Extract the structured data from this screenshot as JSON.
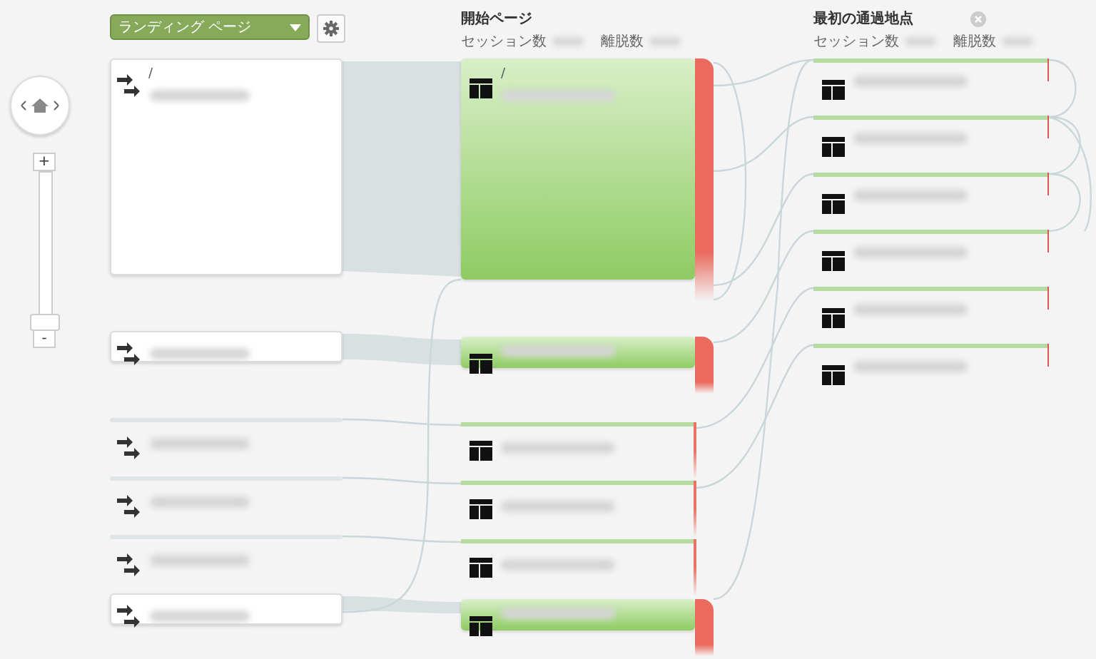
{
  "dimension_selector": {
    "label": "ランディング ページ"
  },
  "navigation": {
    "zoom_in": "+",
    "zoom_out": "-"
  },
  "columns": [
    {
      "title": "開始ページ",
      "metrics": [
        "セッション数",
        "離脱数"
      ],
      "closable": false
    },
    {
      "title": "最初の通過地点",
      "metrics": [
        "セッション数",
        "離脱数"
      ],
      "closable": true
    }
  ],
  "landing_pages": [
    {
      "kind": "tall",
      "path": "/"
    },
    {
      "kind": "bar"
    },
    {
      "kind": "line"
    },
    {
      "kind": "line"
    },
    {
      "kind": "line"
    },
    {
      "kind": "bar"
    }
  ],
  "starting_pages": [
    {
      "kind": "tall",
      "path": "/"
    },
    {
      "kind": "bar"
    },
    {
      "kind": "line"
    },
    {
      "kind": "line"
    },
    {
      "kind": "line"
    },
    {
      "kind": "bar"
    }
  ],
  "first_interactions": [
    {
      "kind": "line"
    },
    {
      "kind": "line"
    },
    {
      "kind": "line"
    },
    {
      "kind": "line"
    },
    {
      "kind": "line"
    },
    {
      "kind": "line"
    }
  ]
}
